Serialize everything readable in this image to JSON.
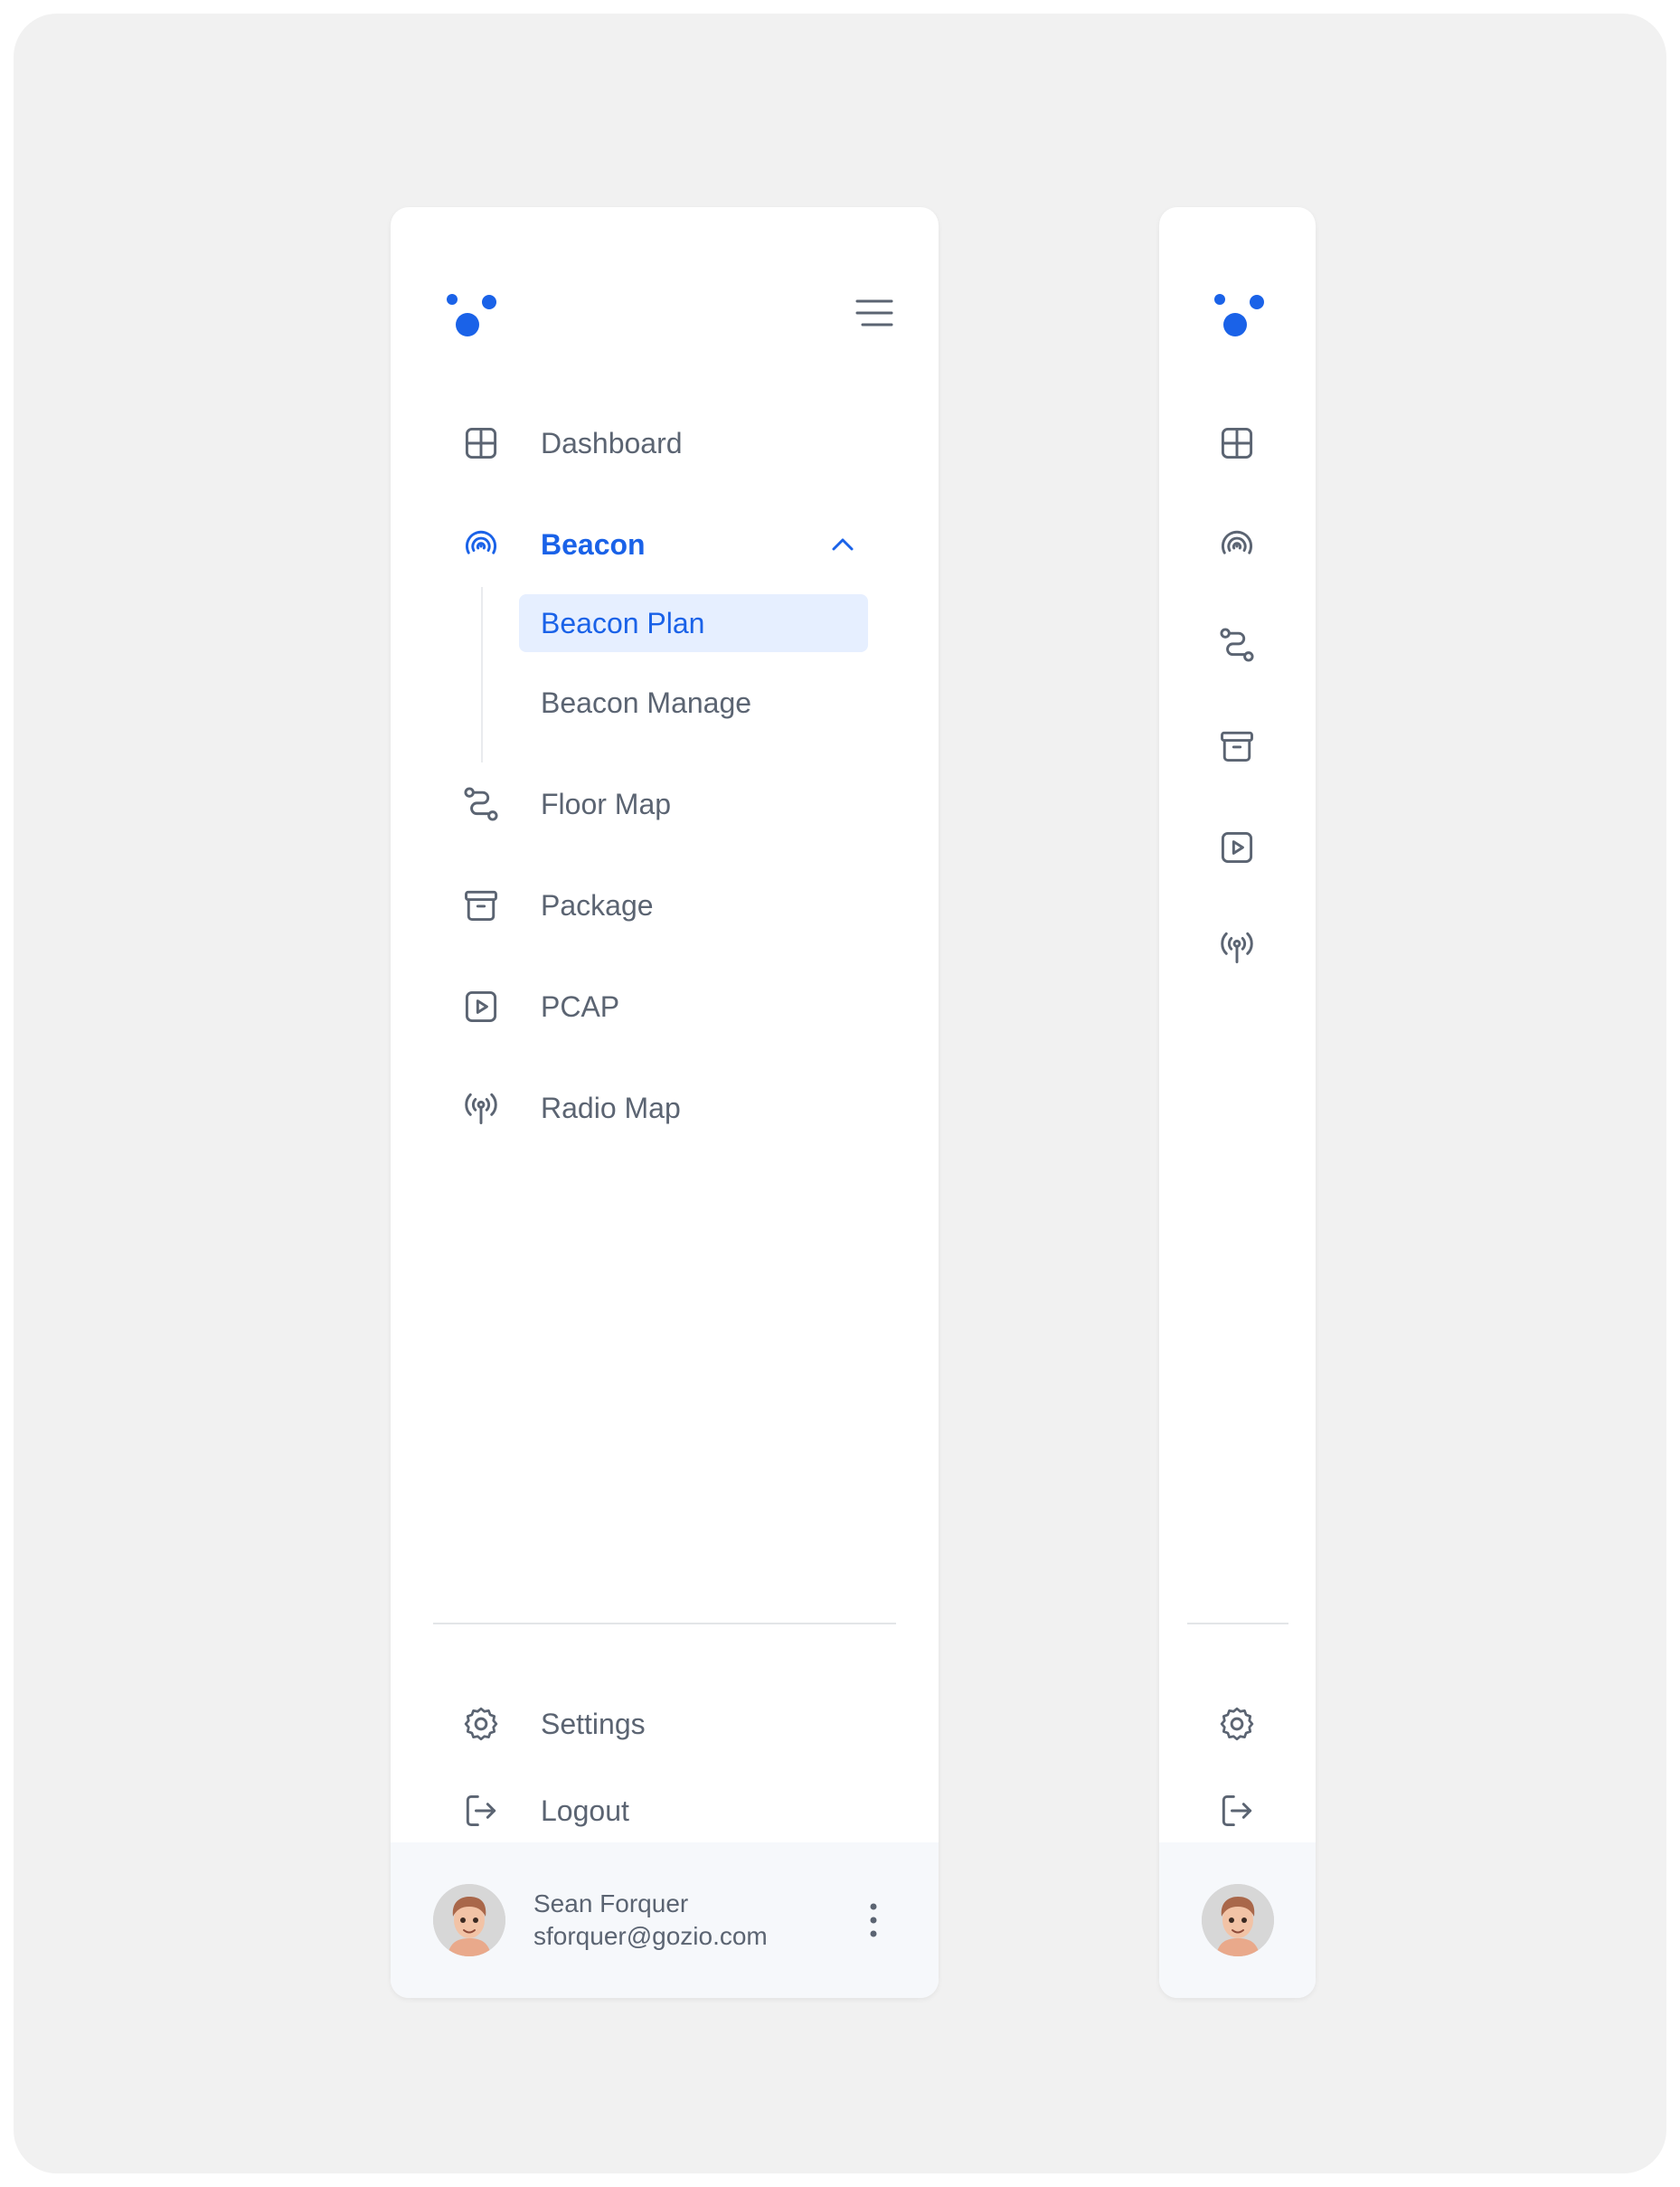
{
  "colors": {
    "accent": "#1a62e8",
    "icon": "#5b6472",
    "active_bg": "#e6efff",
    "panel": "#ffffff",
    "canvas": "#f1f1f1"
  },
  "sidebar_expanded": {
    "nav": [
      {
        "label": "Dashboard",
        "icon": "grid-icon"
      },
      {
        "label": "Beacon",
        "icon": "beacon-signal-icon",
        "active": true,
        "expanded": true,
        "children": [
          {
            "label": "Beacon Plan",
            "selected": true
          },
          {
            "label": "Beacon Manage",
            "selected": false
          }
        ]
      },
      {
        "label": "Floor Map",
        "icon": "route-icon"
      },
      {
        "label": "Package",
        "icon": "archive-icon"
      },
      {
        "label": "PCAP",
        "icon": "play-square-icon"
      },
      {
        "label": "Radio Map",
        "icon": "antenna-icon"
      }
    ],
    "footer": [
      {
        "label": "Settings",
        "icon": "gear-icon"
      },
      {
        "label": "Logout",
        "icon": "logout-icon"
      }
    ],
    "user": {
      "name": "Sean Forquer",
      "email": "sforquer@gozio.com"
    }
  },
  "sidebar_collapsed": {
    "nav_icons": [
      "grid-icon",
      "beacon-signal-icon",
      "route-icon",
      "archive-icon",
      "play-square-icon",
      "antenna-icon"
    ],
    "footer_icons": [
      "gear-icon",
      "logout-icon"
    ]
  }
}
